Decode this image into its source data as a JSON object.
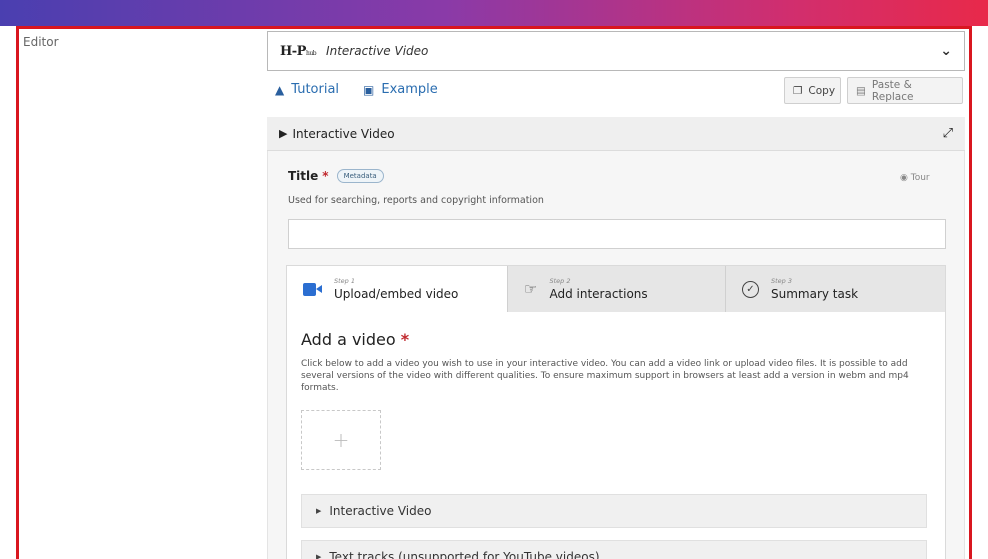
{
  "editor": {
    "label": "Editor"
  },
  "content_selector": {
    "logo_main": "H-P",
    "logo_sub": "hub",
    "content_type": "Interactive Video"
  },
  "links": {
    "tutorial": "Tutorial",
    "example": "Example"
  },
  "buttons": {
    "copy": "Copy",
    "paste_replace": "Paste & Replace"
  },
  "section": {
    "title": "Interactive Video"
  },
  "title_field": {
    "label": "Title",
    "required_marker": "*",
    "metadata_badge": "Metadata",
    "tour": "Tour",
    "description": "Used for searching, reports and copyright information",
    "value": ""
  },
  "wizard": {
    "tabs": [
      {
        "step": "Step 1",
        "title": "Upload/embed video",
        "icon": "video-camera-icon",
        "active": true
      },
      {
        "step": "Step 2",
        "title": "Add interactions",
        "icon": "tap-pointer-icon",
        "active": false
      },
      {
        "step": "Step 3",
        "title": "Summary task",
        "icon": "check-circle-icon",
        "active": false
      }
    ],
    "add_video": {
      "title": "Add a video",
      "required_marker": "*",
      "description": "Click below to add a video you wish to use in your interactive video. You can add a video link or upload video files. It is possible to add several versions of the video with different qualities. To ensure maximum support in browsers at least add a version in webm and mp4 formats.",
      "add_symbol": "+"
    },
    "collapsibles": [
      {
        "label": "Interactive Video"
      },
      {
        "label": "Text tracks (unsupported for YouTube videos)"
      }
    ]
  },
  "colors": {
    "accent_blue": "#2b6ed1",
    "frame_red": "#d9161f",
    "required_red": "#c0282d"
  }
}
